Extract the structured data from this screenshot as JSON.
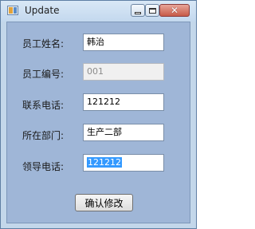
{
  "window": {
    "title": "Update",
    "controls": {
      "minimize": "minimize",
      "maximize": "maximize",
      "close": "✕"
    }
  },
  "form": {
    "fields": [
      {
        "label": "员工姓名:",
        "value": "韩治",
        "enabled": true
      },
      {
        "label": "员工编号:",
        "value": "001",
        "enabled": false
      },
      {
        "label": "联系电话:",
        "value": "121212",
        "enabled": true
      },
      {
        "label": "所在部门:",
        "value": "生产二部",
        "enabled": true
      },
      {
        "label": "领导电话:",
        "value": "121212",
        "enabled": true,
        "selected": true
      }
    ],
    "confirm_label": "确认修改"
  },
  "colors": {
    "window_frame": "#c3d7ea",
    "client_background": "#9fb6d7",
    "selection": "#3399ff",
    "close_button": "#c75a48"
  }
}
